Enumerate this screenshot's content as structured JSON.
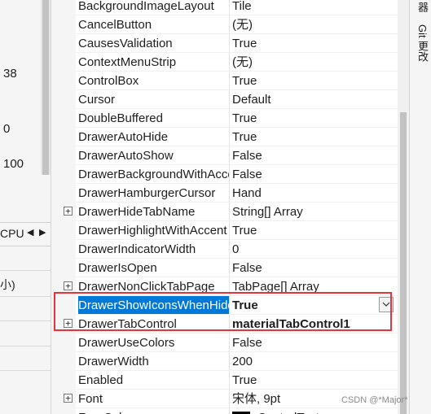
{
  "left_panel": {
    "numbers": [
      "38",
      "0",
      "100"
    ],
    "tab_label": "CPU",
    "bottom_row_text": "小)"
  },
  "right_strip": {
    "labels": [
      "器",
      "Git 更改"
    ]
  },
  "properties": [
    {
      "name": "BackgroundImageLayout",
      "value": "Tile",
      "expandable": false
    },
    {
      "name": "CancelButton",
      "value": "(无)",
      "expandable": false
    },
    {
      "name": "CausesValidation",
      "value": "True",
      "expandable": false
    },
    {
      "name": "ContextMenuStrip",
      "value": "(无)",
      "expandable": false
    },
    {
      "name": "ControlBox",
      "value": "True",
      "expandable": false
    },
    {
      "name": "Cursor",
      "value": "Default",
      "expandable": false
    },
    {
      "name": "DoubleBuffered",
      "value": "True",
      "expandable": false
    },
    {
      "name": "DrawerAutoHide",
      "value": "True",
      "expandable": false
    },
    {
      "name": "DrawerAutoShow",
      "value": "False",
      "expandable": false
    },
    {
      "name": "DrawerBackgroundWithAccent",
      "value": "False",
      "expandable": false
    },
    {
      "name": "DrawerHamburgerCursor",
      "value": "Hand",
      "expandable": false
    },
    {
      "name": "DrawerHideTabName",
      "value": "String[] Array",
      "expandable": true
    },
    {
      "name": "DrawerHighlightWithAccent",
      "value": "True",
      "expandable": false
    },
    {
      "name": "DrawerIndicatorWidth",
      "value": "0",
      "expandable": false
    },
    {
      "name": "DrawerIsOpen",
      "value": "False",
      "expandable": false
    },
    {
      "name": "DrawerNonClickTabPage",
      "value": "TabPage[] Array",
      "expandable": true
    },
    {
      "name": "DrawerShowIconsWhenHidden",
      "value": "True",
      "expandable": false,
      "selected": true,
      "bold": true
    },
    {
      "name": "DrawerTabControl",
      "value": "materialTabControl1",
      "expandable": true,
      "bold": true
    },
    {
      "name": "DrawerUseColors",
      "value": "False",
      "expandable": false
    },
    {
      "name": "DrawerWidth",
      "value": "200",
      "expandable": false
    },
    {
      "name": "Enabled",
      "value": "True",
      "expandable": false
    },
    {
      "name": "Font",
      "value": "宋体, 9pt",
      "expandable": true
    },
    {
      "name": "ForeColor",
      "value": "ControlText",
      "expandable": false,
      "swatch": "#000000"
    }
  ],
  "watermark": "CSDN @*Major*",
  "colors": {
    "selection": "#0078d7",
    "highlight_border": "#e8323c"
  }
}
